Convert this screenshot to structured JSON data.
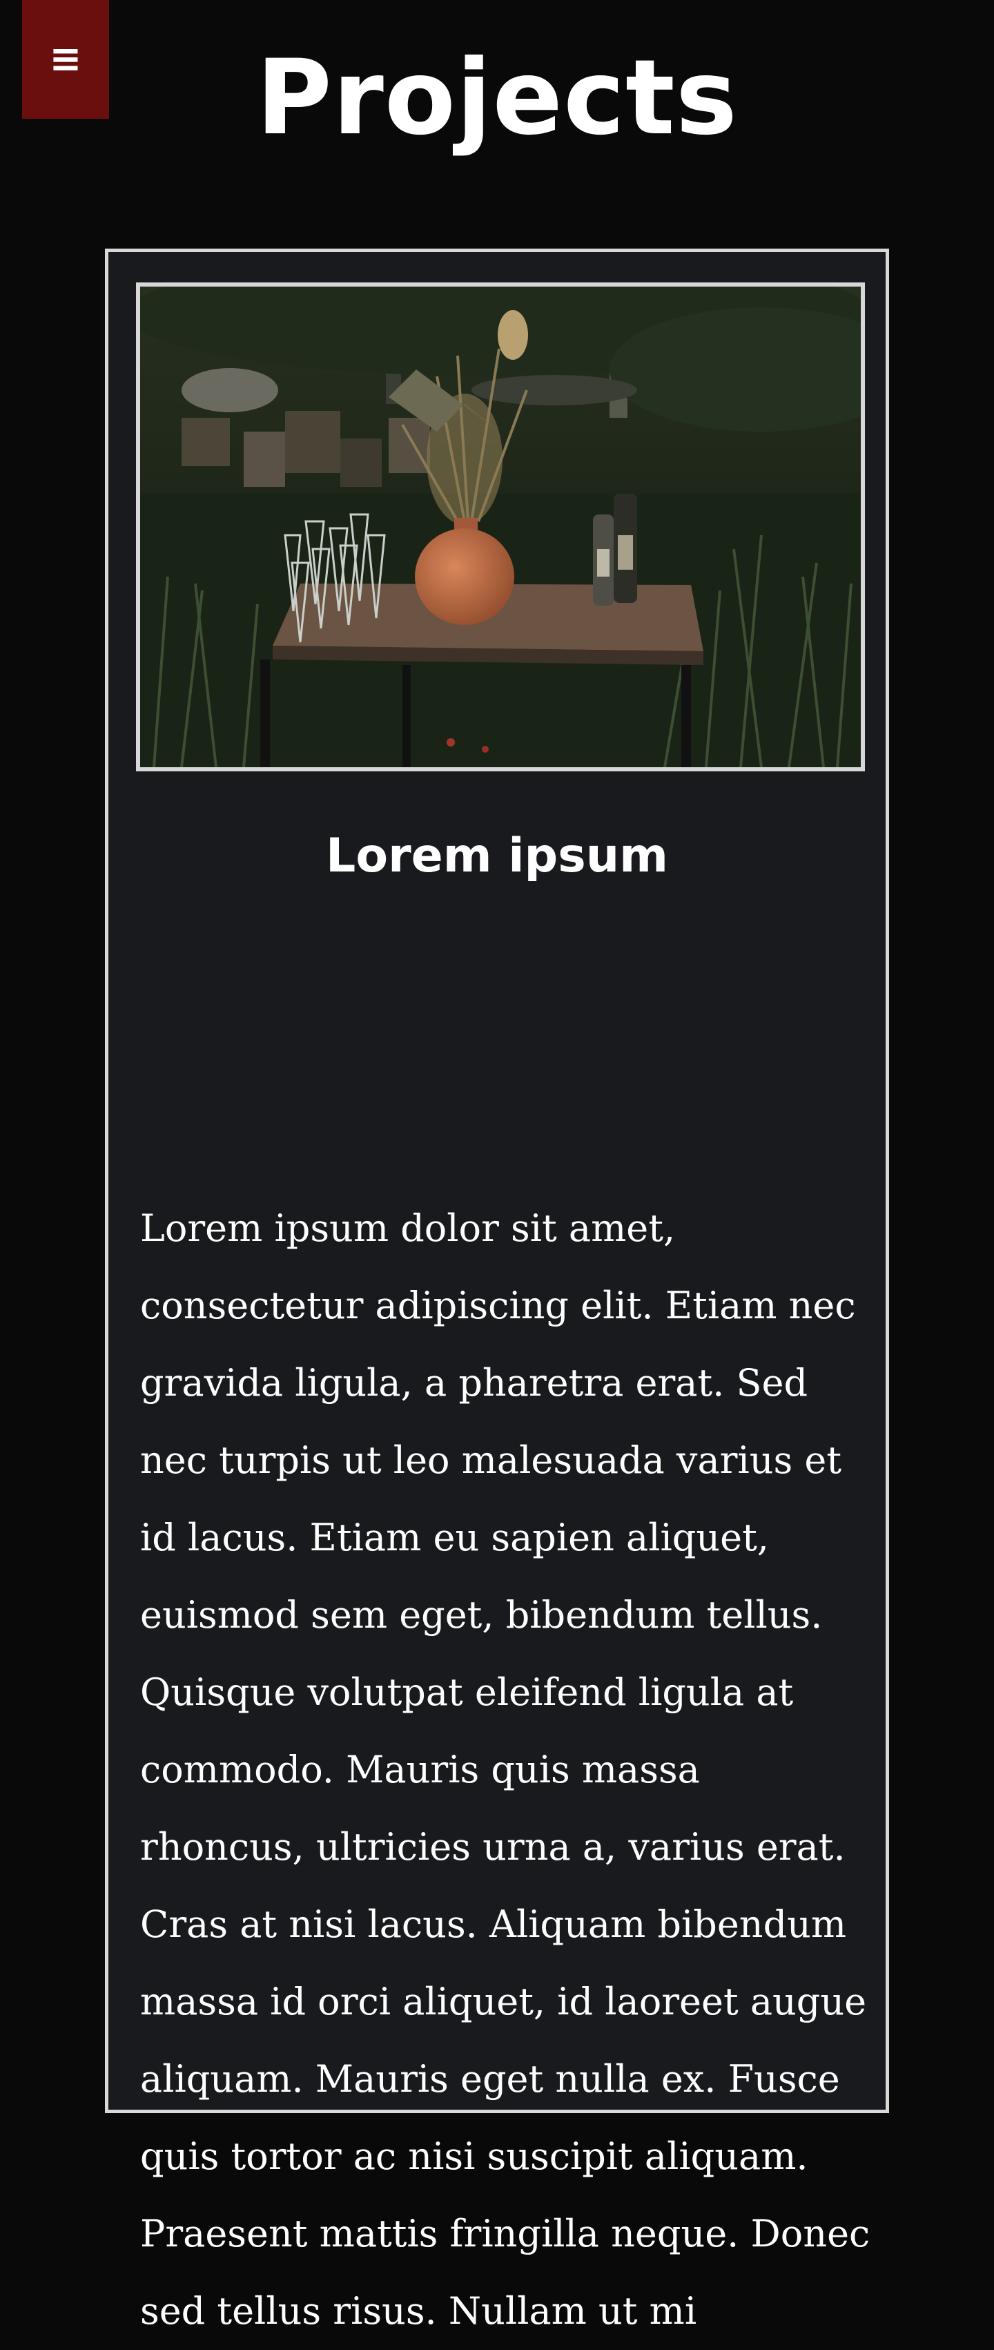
{
  "header": {
    "title": "Projects",
    "menu_icon": "≡",
    "menu_icon_name": "hamburger-icon"
  },
  "colors": {
    "page_background": "#0a090a",
    "menu_button": "#6b0e0e",
    "card_background": "#181a1d",
    "card_border": "#d8d8d8",
    "text": "#ffffff"
  },
  "project": {
    "heading": "Lorem ipsum",
    "body": "Lorem ipsum dolor sit amet, consectetur adipiscing elit. Etiam nec gravida ligula, a pharetra erat. Sed nec turpis ut leo malesuada varius et id lacus. Etiam eu sapien aliquet, euismod sem eget, bibendum tellus. Quisque volutpat eleifend ligula at commodo. Mauris quis massa rhoncus, ultricies urna a, varius erat. Cras at nisi lacus. Aliquam bibendum massa id orci aliquet, id laoreet augue aliquam. Mauris eget nulla ex. Fusce quis tortor ac nisi suscipit aliquam. Praesent mattis fringilla neque. Donec sed tellus risus. Nullam ut mi"
  }
}
